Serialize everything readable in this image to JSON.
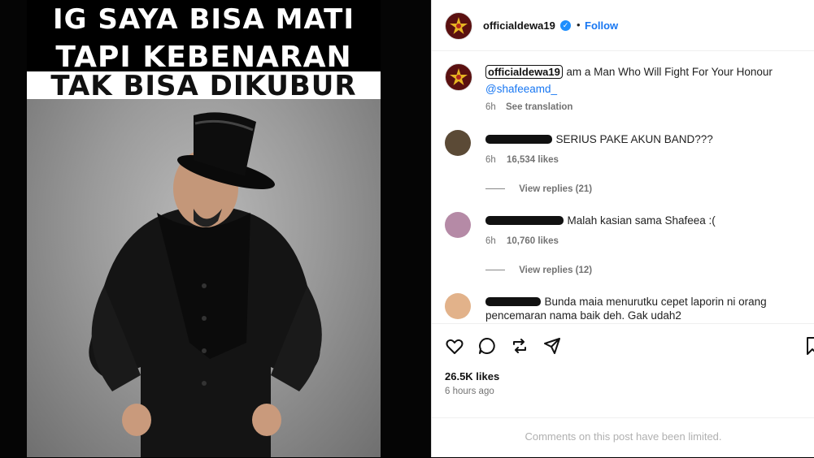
{
  "meme": {
    "line1": "IG SAYA BISA MATI",
    "line2": "TAPI KEBENARAN",
    "line3": "TAK BISA DIKUBUR"
  },
  "header": {
    "username": "officialdewa19",
    "separator": "•",
    "follow_label": "Follow"
  },
  "caption": {
    "username": "officialdewa19",
    "text": "am a Man Who Will Fight For Your Honour",
    "mention": "@shafeeamd_",
    "time": "6h",
    "translate": "See translation"
  },
  "comments": [
    {
      "text": "SERIUS PAKE AKUN BAND???",
      "time": "6h",
      "likes": "16,534 likes",
      "replies": "View replies (21)"
    },
    {
      "text": "Malah kasian sama Shafeea :(",
      "time": "6h",
      "likes": "10,760 likes",
      "replies": "View replies (12)"
    },
    {
      "text_line1": "Bunda maia menurutku cepet laporin ni orang",
      "text_line2": "pencemaran nama baik deh. Gak udah2"
    }
  ],
  "post": {
    "likes": "26.5K likes",
    "time": "6 hours ago",
    "limited_notice": "Comments on this post have been limited."
  },
  "colors": {
    "link": "#1877f2",
    "verified": "#1e8ffe",
    "meta": "#737373"
  },
  "icons": [
    "heart-icon",
    "comment-icon",
    "repost-icon",
    "share-icon",
    "bookmark-icon",
    "verified-badge-icon"
  ]
}
